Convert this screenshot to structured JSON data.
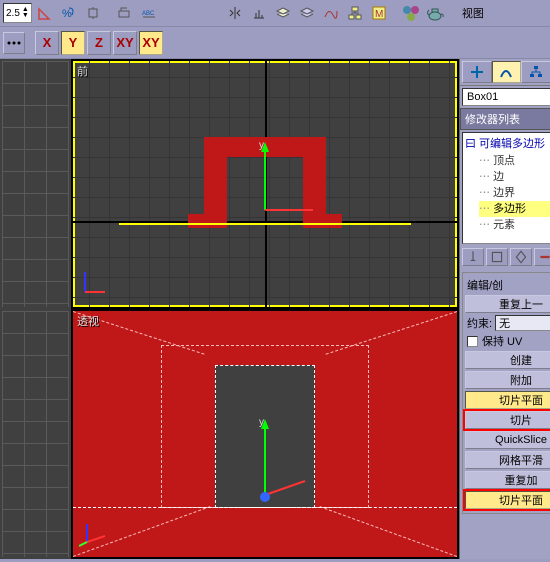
{
  "toolbar": {
    "spinner_value": "2.5",
    "menu_view": "视图"
  },
  "axis": {
    "x": "X",
    "y": "Y",
    "z": "Z",
    "xy": "XY",
    "xy2": "XY"
  },
  "viewports": {
    "front_label": "前",
    "persp_label": "透视",
    "gizmo_y": "y"
  },
  "sidebar": {
    "obj_name": "Box01",
    "mod_list_label": "修改器列表",
    "stack_root": "曰 可编辑多边形",
    "stack_items": [
      "顶点",
      "边",
      "边界",
      "多边形",
      "元素"
    ],
    "stack_selected_index": 3
  },
  "rollout": {
    "edit_label": "编辑/创",
    "repeat_last": "重复上一",
    "constraint_label": "约束:",
    "constraint_value": "无",
    "preserve_uv": "保持 UV",
    "create": "创建",
    "attach": "附加",
    "slice_plane": "切片平面",
    "slice": "切片",
    "quickslice": "QuickSlice",
    "msmooth": "网格平滑",
    "tessellate": "重复加",
    "slice_plane2": "切片平面"
  },
  "icons": {
    "angle": "angle-snap-icon",
    "percent": "percent-snap-icon",
    "curve": "curve-icon",
    "abc": "abc-icon",
    "mirror": "mirror-icon",
    "align": "align-icon",
    "layers": "layers-icon",
    "layers2": "layers2-icon",
    "curve2": "curve2-icon",
    "m": "material-icon",
    "balls": "render-icon",
    "teapot": "teapot-icon"
  },
  "chart_data": null
}
